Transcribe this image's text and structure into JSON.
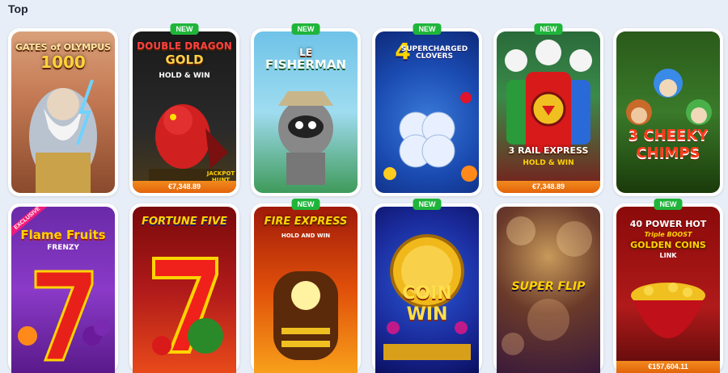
{
  "section": {
    "title": "Top"
  },
  "games": [
    {
      "title_top": "GATES of OLYMPUS",
      "title_bottom": "1000",
      "new": false,
      "jackpot": ""
    },
    {
      "title_top": "DOUBLE DRAGON",
      "title_bottom": "GOLD",
      "sub": "HOLD & WIN",
      "corner": "JACKPOT HUNT",
      "new": true,
      "new_label": "NEW",
      "jackpot": "€7,348.89"
    },
    {
      "title_top": "LE",
      "title_bottom": "FISHERMAN",
      "new": true,
      "new_label": "NEW",
      "jackpot": ""
    },
    {
      "title_top": "4",
      "title_bottom": "SUPERCHARGED CLOVERS",
      "new": true,
      "new_label": "NEW",
      "jackpot": ""
    },
    {
      "title_top": "3 RAIL EXPRESS",
      "title_bottom": "HOLD & WIN",
      "new": true,
      "new_label": "NEW",
      "jackpot": "€7,348.89"
    },
    {
      "title_top": "3 CHEEKY",
      "title_bottom": "CHIMPS",
      "new": false,
      "jackpot": ""
    },
    {
      "title_top": "Flame Fruits",
      "title_bottom": "FRENZY",
      "ribbon": "EXCLUSIVE",
      "new": false,
      "jackpot": ""
    },
    {
      "title_top": "FORTUNE FIVE",
      "title_bottom": "",
      "new": false,
      "jackpot": ""
    },
    {
      "title_top": "FIRE EXPRESS",
      "title_bottom": "HOLD AND WIN",
      "new": true,
      "new_label": "NEW",
      "jackpot": ""
    },
    {
      "title_top": "COIN",
      "title_bottom": "WIN",
      "new": true,
      "new_label": "NEW",
      "jackpot": ""
    },
    {
      "title_top": "SUPER FLIP",
      "title_bottom": "",
      "new": false,
      "jackpot": ""
    },
    {
      "title_top": "40 POWER HOT",
      "title_mid": "Triple BOOST",
      "title_bottom": "GOLDEN COINS",
      "sub": "LINK",
      "new": true,
      "new_label": "NEW",
      "jackpot": "€157,604.11"
    }
  ],
  "colors": {
    "new_badge": "#1fb53a",
    "jackpot_bar": "#f28a1e",
    "background": "#e8eef7"
  }
}
